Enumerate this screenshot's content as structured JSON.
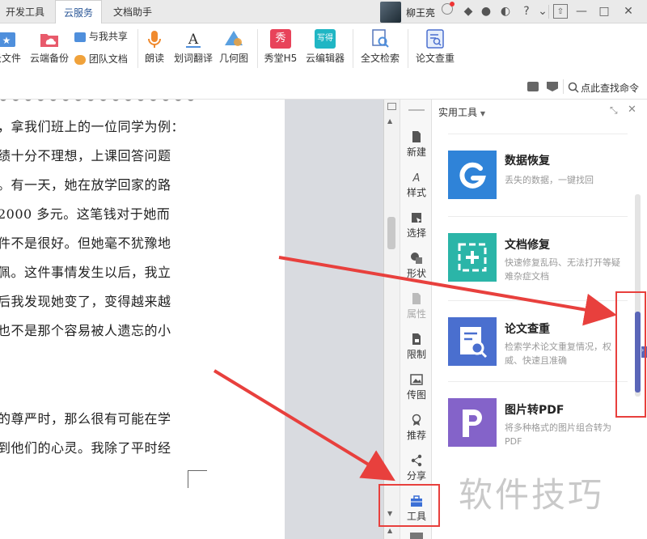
{
  "tabs": [
    {
      "label": "开发工具",
      "active": false
    },
    {
      "label": "云服务",
      "active": true
    },
    {
      "label": "文档助手",
      "active": false
    }
  ],
  "user": {
    "name": "柳王亮"
  },
  "window_controls": [
    "?",
    "—",
    "□",
    "✕"
  ],
  "ribbon": {
    "cloud_file": "云文件",
    "cloud_backup": "云端备份",
    "share_with_me": "与我共享",
    "team_docs": "团队文档",
    "read_aloud": "朗读",
    "translate": "划词翻译",
    "geometry": "几何图",
    "h5": "秀堂H5",
    "cloud_editor": "云编辑器",
    "full_search": "全文检索",
    "paper_check": "论文查重",
    "h5_icon_text": "秀",
    "editor_icon_text": "写得"
  },
  "cmdbar": {
    "search": "点此查找命令"
  },
  "document": {
    "lines": [
      "，拿我们班上的一位同学为例：",
      "绩十分不理想，上课回答问题",
      "。有一天，她在放学回家的路",
      " 2000 多元。这笔钱对于她而",
      "件不是很好。但她毫不犹豫地",
      "佩。这件事情发生以后，我立",
      "后我发现她变了，变得越来越",
      "也不是那个容易被人遗忘的小",
      "的尊严时，那么很有可能在学",
      "到他们的心灵。我除了平时经"
    ]
  },
  "toolrail": [
    {
      "label": "新建",
      "icon": "new-doc-icon"
    },
    {
      "label": "样式",
      "icon": "style-icon"
    },
    {
      "label": "选择",
      "icon": "select-icon"
    },
    {
      "label": "形状",
      "icon": "shape-icon"
    },
    {
      "label": "属性",
      "icon": "properties-icon"
    },
    {
      "label": "限制",
      "icon": "restrict-icon"
    },
    {
      "label": "传图",
      "icon": "upload-image-icon"
    },
    {
      "label": "推荐",
      "icon": "recommend-icon"
    },
    {
      "label": "分享",
      "icon": "share-icon"
    },
    {
      "label": "工具",
      "icon": "toolbox-icon"
    }
  ],
  "panel": {
    "title": "实用工具",
    "cards": [
      {
        "title": "数据恢复",
        "desc": "丢失的数据，一键找回",
        "icon": "data-recovery-icon",
        "color": "#2f83d8"
      },
      {
        "title": "文档修复",
        "desc": "快速修复乱码、无法打开等疑难杂症文档",
        "icon": "doc-repair-icon",
        "color": "#2bb5a8"
      },
      {
        "title": "论文查重",
        "desc": "检索学术论文重复情况，权威、快速且准确",
        "icon": "paper-check-icon",
        "color": "#4a6fcf"
      },
      {
        "title": "图片转PDF",
        "desc": "将多种格式的图片组合转为PDF",
        "icon": "image-to-pdf-icon",
        "color": "#8463c9"
      }
    ]
  },
  "watermark": "软件技巧",
  "colors": {
    "accent": "#2b5797",
    "annotation": "#e8403d"
  }
}
